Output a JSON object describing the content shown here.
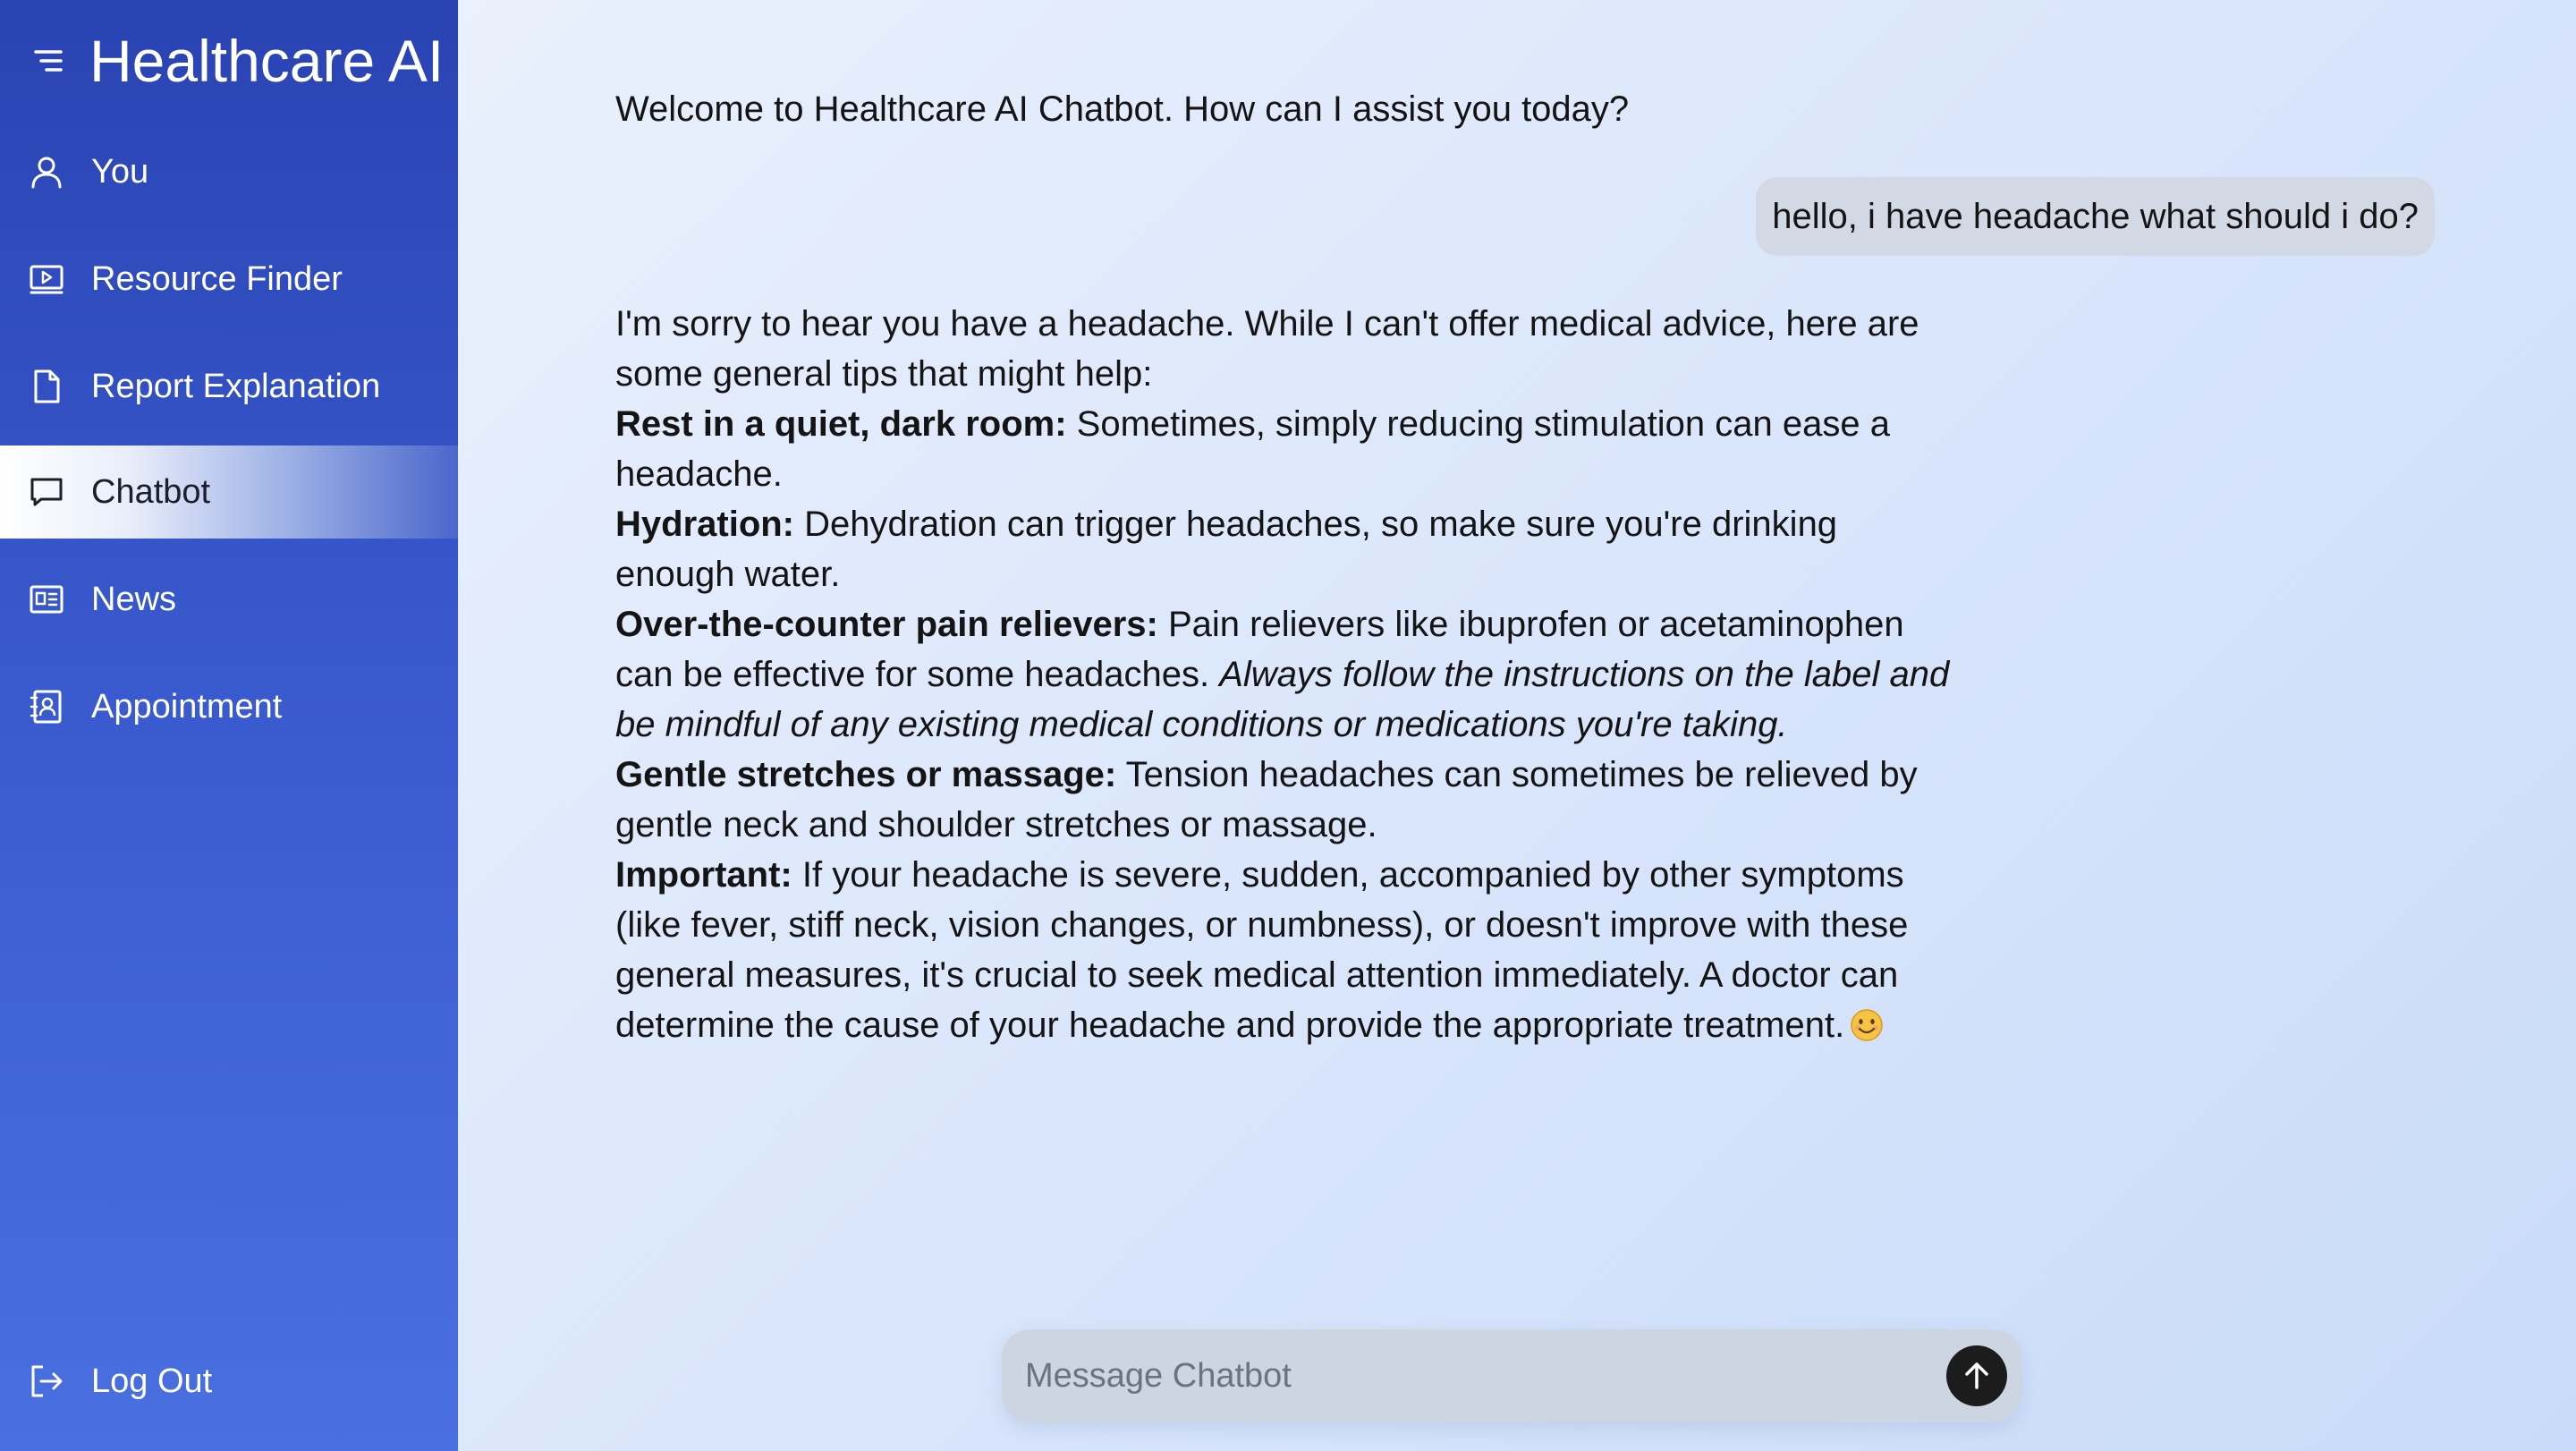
{
  "app": {
    "title": "Healthcare AI"
  },
  "sidebar": {
    "items": [
      {
        "label": "You",
        "icon": "user-icon"
      },
      {
        "label": "Resource Finder",
        "icon": "video-icon"
      },
      {
        "label": "Report Explanation",
        "icon": "document-icon"
      },
      {
        "label": "Chatbot",
        "icon": "chat-icon",
        "active": true
      },
      {
        "label": "News",
        "icon": "newspaper-icon"
      },
      {
        "label": "Appointment",
        "icon": "contact-book-icon"
      }
    ],
    "logout": {
      "label": "Log Out",
      "icon": "logout-icon"
    }
  },
  "chat": {
    "welcome": "Welcome to Healthcare AI Chatbot. How can I assist you today?",
    "user_message": "hello, i have headache what should i do?",
    "response": {
      "intro": "I'm sorry to hear you have a headache. While I can't offer medical advice, here are some general tips that might help:",
      "tips": [
        {
          "title": "Rest in a quiet, dark room:",
          "text": " Sometimes, simply reducing stimulation can ease a headache."
        },
        {
          "title": "Hydration:",
          "text": " Dehydration can trigger headaches, so make sure you're drinking enough water."
        },
        {
          "title": "Over-the-counter pain relievers:",
          "text": " Pain relievers like ibuprofen or acetaminophen can be effective for some headaches. ",
          "italic": "Always follow the instructions on the label and be mindful of any existing medical conditions or medications you're taking."
        },
        {
          "title": "Gentle stretches or massage:",
          "text": " Tension headaches can sometimes be relieved by gentle neck and shoulder stretches or massage."
        },
        {
          "title": "Important:",
          "text": " If your headache is severe, sudden, accompanied by other symptoms (like fever, stiff neck, vision changes, or numbness), or doesn't improve with these general measures, it's crucial to seek medical attention immediately. A doctor can determine the cause of your headache and provide the appropriate treatment."
        }
      ],
      "emoji": "smiling-face-icon"
    }
  },
  "composer": {
    "placeholder": "Message Chatbot",
    "value": "",
    "send_icon": "arrow-up-icon"
  },
  "colors": {
    "sidebar_top": "#2a43b3",
    "sidebar_bottom": "#4a6fe0",
    "main_bg": "#dde8fb",
    "user_bubble": "#d3d9e4",
    "send_button": "#1c1c1c"
  }
}
